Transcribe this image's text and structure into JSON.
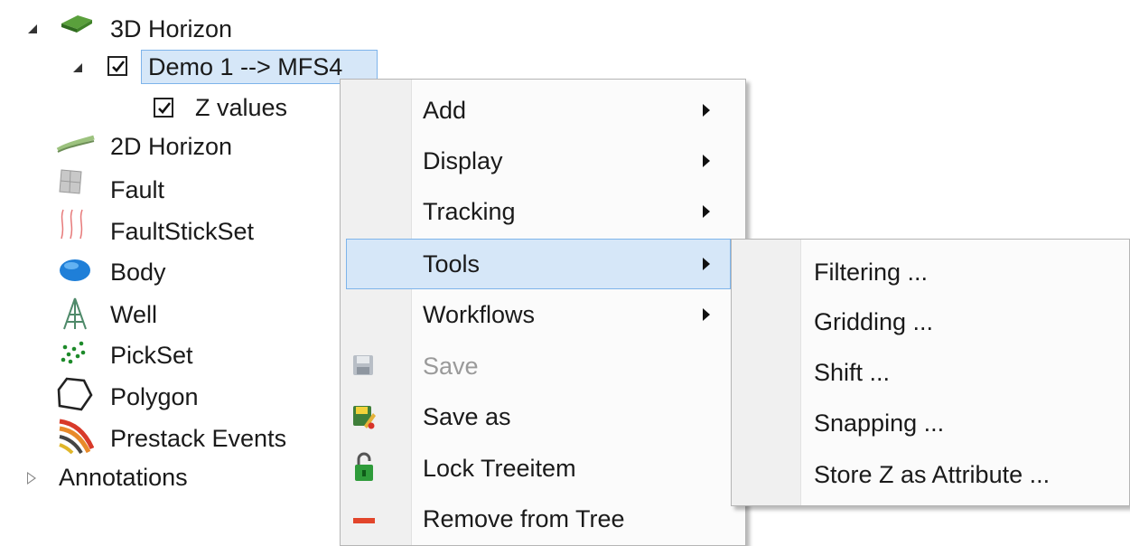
{
  "tree": {
    "horizon3d": "3D Horizon",
    "demo": "Demo 1 --> MFS4",
    "zvalues": "Z values",
    "horizon2d": "2D Horizon",
    "fault": "Fault",
    "faultstickset": "FaultStickSet",
    "body": "Body",
    "well": "Well",
    "pickset": "PickSet",
    "polygon": "Polygon",
    "prestack": "Prestack Events",
    "annotations": "Annotations"
  },
  "context_menu": {
    "items": [
      {
        "label": "Add",
        "submenu": true
      },
      {
        "label": "Display",
        "submenu": true
      },
      {
        "label": "Tracking",
        "submenu": true
      },
      {
        "label": "Tools",
        "submenu": true,
        "highlighted": true
      },
      {
        "label": "Workflows",
        "submenu": true
      },
      {
        "label": "Save",
        "disabled": true,
        "icon": "save-icon"
      },
      {
        "label": "Save as",
        "icon": "save-as-icon"
      },
      {
        "label": "Lock Treeitem",
        "icon": "lock-icon"
      },
      {
        "label": "Remove from Tree",
        "icon": "remove-icon"
      }
    ]
  },
  "tools_submenu": {
    "items": [
      {
        "label": "Filtering ..."
      },
      {
        "label": "Gridding ..."
      },
      {
        "label": "Shift ..."
      },
      {
        "label": "Snapping ..."
      },
      {
        "label": "Store Z as Attribute ..."
      }
    ]
  },
  "colors": {
    "selection_bg": "#d6e7f8",
    "selection_border": "#7eb4ea",
    "menu_bg": "#fbfbfb",
    "lock_green": "#2e9b3a",
    "remove_red": "#e2452b"
  }
}
